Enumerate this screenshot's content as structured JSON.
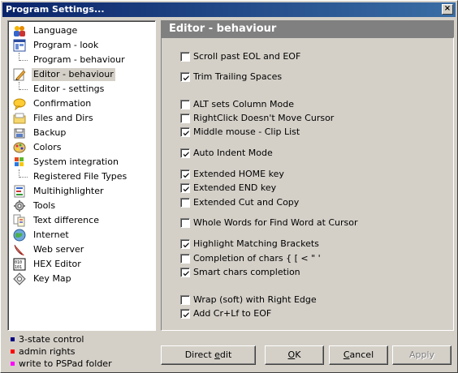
{
  "window": {
    "title": "Program Settings...",
    "close_label": "×"
  },
  "tree": {
    "items": [
      {
        "label": "Language",
        "icon": "language-icon",
        "child": false,
        "selected": false
      },
      {
        "label": "Program - look",
        "icon": "program-look-icon",
        "child": false,
        "selected": false
      },
      {
        "label": "Program - behaviour",
        "icon": "",
        "child": true,
        "selected": false
      },
      {
        "label": "Editor - behaviour",
        "icon": "pencil-icon",
        "child": false,
        "selected": true
      },
      {
        "label": "Editor - settings",
        "icon": "",
        "child": true,
        "selected": false
      },
      {
        "label": "Confirmation",
        "icon": "speech-bubble-icon",
        "child": false,
        "selected": false
      },
      {
        "label": "Files and Dirs",
        "icon": "folder-icon",
        "child": false,
        "selected": false
      },
      {
        "label": "Backup",
        "icon": "backup-icon",
        "child": false,
        "selected": false
      },
      {
        "label": "Colors",
        "icon": "palette-icon",
        "child": false,
        "selected": false
      },
      {
        "label": "System integration",
        "icon": "windows-icon",
        "child": false,
        "selected": false
      },
      {
        "label": "Registered File Types",
        "icon": "",
        "child": true,
        "selected": false
      },
      {
        "label": "Multihighlighter",
        "icon": "multihighlighter-icon",
        "child": false,
        "selected": false
      },
      {
        "label": "Tools",
        "icon": "tools-icon",
        "child": false,
        "selected": false
      },
      {
        "label": "Text difference",
        "icon": "text-difference-icon",
        "child": false,
        "selected": false
      },
      {
        "label": "Internet",
        "icon": "globe-icon",
        "child": false,
        "selected": false
      },
      {
        "label": "Web server",
        "icon": "feather-icon",
        "child": false,
        "selected": false
      },
      {
        "label": "HEX Editor",
        "icon": "hex-icon",
        "child": false,
        "selected": false
      },
      {
        "label": "Key Map",
        "icon": "keymap-icon",
        "child": false,
        "selected": false
      }
    ]
  },
  "legend": [
    {
      "label": "3-state control",
      "color": "#00007f"
    },
    {
      "label": "admin rights",
      "color": "#ff0000"
    },
    {
      "label": "write to PSPad folder",
      "color": "#ff00ff"
    }
  ],
  "panel": {
    "title": "Editor - behaviour",
    "options": [
      {
        "label": "Scroll past EOL and EOF",
        "checked": false
      },
      {
        "label": "Trim Trailing Spaces",
        "checked": true
      },
      {
        "label": "ALT sets Column Mode",
        "checked": false
      },
      {
        "label": "RightClick Doesn't Move Cursor",
        "checked": false
      },
      {
        "label": "Middle mouse - Clip List",
        "checked": true
      },
      {
        "label": "Auto Indent Mode",
        "checked": true
      },
      {
        "label": "Extended HOME key",
        "checked": true
      },
      {
        "label": "Extended END key",
        "checked": true
      },
      {
        "label": "Extended Cut and Copy",
        "checked": false
      },
      {
        "label": "Whole Words for Find Word at Cursor",
        "checked": false
      },
      {
        "label": "Highlight Matching Brackets",
        "checked": true
      },
      {
        "label": "Completion of chars { [ < \" '",
        "checked": false
      },
      {
        "label": "Smart chars completion",
        "checked": true
      },
      {
        "label": "Wrap (soft) with Right Edge",
        "checked": false
      },
      {
        "label": "Add Cr+Lf to EOF",
        "checked": true
      }
    ]
  },
  "buttons": {
    "direct_edit": {
      "pre": "Direct ",
      "ul": "e",
      "post": "dit"
    },
    "ok": {
      "pre": "",
      "ul": "O",
      "post": "K"
    },
    "cancel": {
      "pre": "",
      "ul": "C",
      "post": "ancel"
    },
    "apply": {
      "pre": "",
      "ul": "",
      "post": "Apply"
    }
  }
}
